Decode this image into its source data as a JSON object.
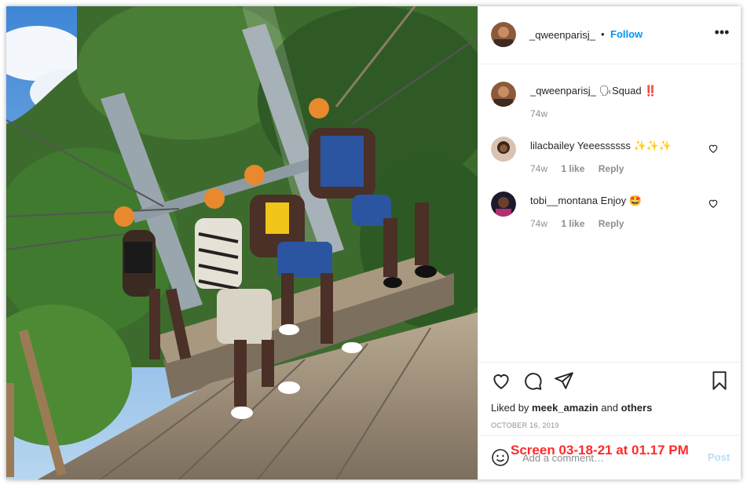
{
  "post": {
    "author": "_qweenparisj_",
    "follow_label": "Follow",
    "separator": "•",
    "more_label": "•••"
  },
  "caption": {
    "username": "_qweenparisj_",
    "text": "🗣Squad ‼️",
    "age": "74w"
  },
  "comments": [
    {
      "username": "lilacbailey",
      "text": "Yeeessssss ✨✨✨",
      "age": "74w",
      "likes": "1 like",
      "reply": "Reply"
    },
    {
      "username": "tobi__montana",
      "text": "Enjoy 🤩",
      "age": "74w",
      "likes": "1 like",
      "reply": "Reply"
    }
  ],
  "likes": {
    "prefix": "Liked by",
    "user": "meek_amazin",
    "joiner": "and",
    "others": "others"
  },
  "date": "OCTOBER 16, 2019",
  "add_comment": {
    "placeholder": "Add a comment…",
    "post_label": "Post"
  },
  "watermark": "Screen 03-18-21 at 01.17 PM",
  "icons": [
    "heart-icon",
    "comment-icon",
    "share-icon",
    "bookmark-icon",
    "emoji-icon",
    "more-icon"
  ],
  "colors": {
    "follow": "#0095f6",
    "text": "#262626",
    "muted": "#8e8e8e",
    "watermark": "#ff2a2a"
  }
}
